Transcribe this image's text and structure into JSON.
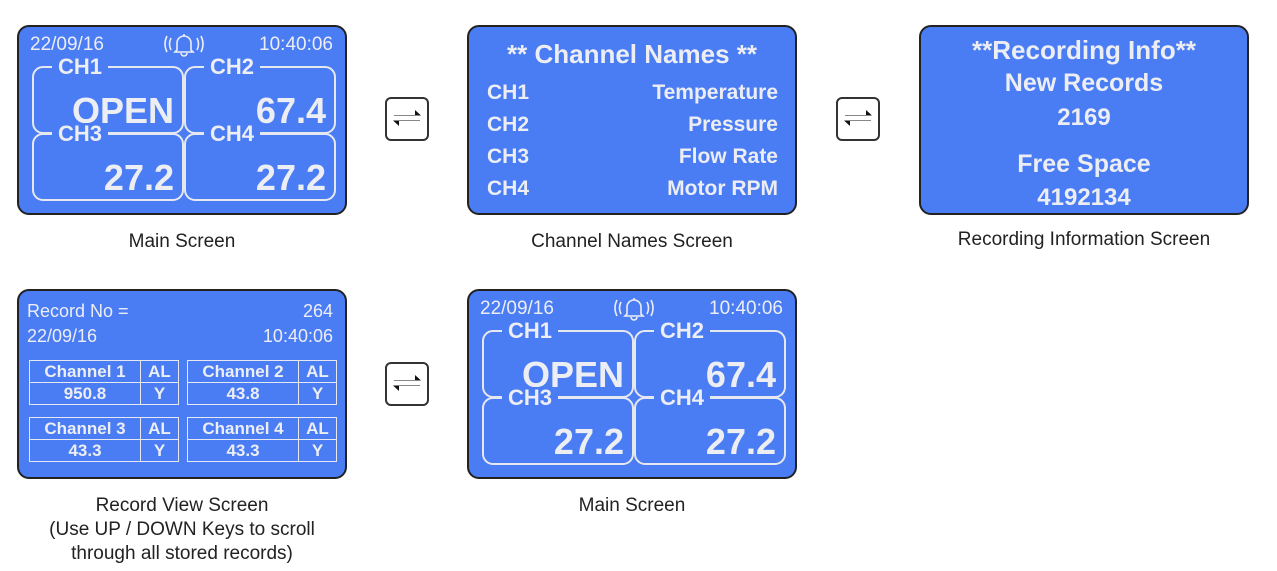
{
  "main_screen": {
    "date": "22/09/16",
    "time": "10:40:06",
    "alarm_icon": "alarm-bell-icon",
    "channels": [
      {
        "label": "CH1",
        "value": "OPEN"
      },
      {
        "label": "CH2",
        "value": "67.4"
      },
      {
        "label": "CH3",
        "value": "27.2"
      },
      {
        "label": "CH4",
        "value": "27.2"
      }
    ],
    "caption": "Main Screen"
  },
  "channel_names_screen": {
    "title": "** Channel Names **",
    "rows": [
      {
        "ch": "CH1",
        "name": "Temperature"
      },
      {
        "ch": "CH2",
        "name": "Pressure"
      },
      {
        "ch": "CH3",
        "name": "Flow Rate"
      },
      {
        "ch": "CH4",
        "name": "Motor RPM"
      }
    ],
    "caption": "Channel Names Screen"
  },
  "recording_info_screen": {
    "title": "**Recording Info**",
    "new_records_label": "New Records",
    "new_records_value": "2169",
    "free_space_label": "Free Space",
    "free_space_value": "4192134",
    "caption": "Recording Information Screen"
  },
  "record_view_screen": {
    "record_label": "Record No =",
    "record_no": "264",
    "date": "22/09/16",
    "time": "10:40:06",
    "channels": [
      {
        "name": "Channel 1",
        "al_label": "AL",
        "value": "950.8",
        "al": "Y"
      },
      {
        "name": "Channel 2",
        "al_label": "AL",
        "value": "43.8",
        "al": "Y"
      },
      {
        "name": "Channel 3",
        "al_label": "AL",
        "value": "43.3",
        "al": "Y"
      },
      {
        "name": "Channel 4",
        "al_label": "AL",
        "value": "43.3",
        "al": "Y"
      }
    ],
    "caption_lines": [
      "Record View Screen",
      "(Use UP / DOWN Keys to scroll",
      "through all stored records)"
    ]
  },
  "swap_icon": "swap-arrows-icon",
  "colors": {
    "screen": "#4a7cf4",
    "text": "#eceef4"
  }
}
